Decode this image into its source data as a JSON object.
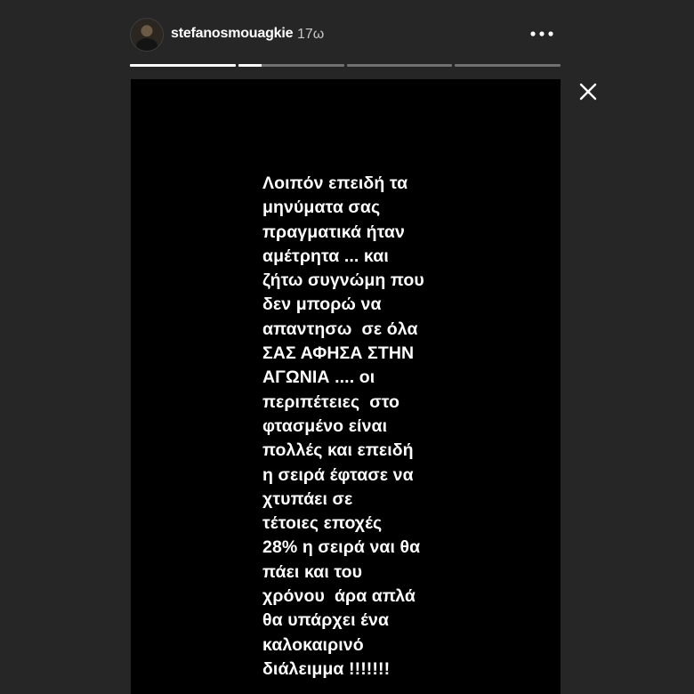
{
  "header": {
    "username": "stefanosmouagkie",
    "time_ago": "17ω",
    "avatar_icon": "profile-avatar",
    "more_icon": "more-horizontal-icon"
  },
  "progress": {
    "segment_count": 4,
    "segments_fill": [
      1,
      0.22,
      0,
      0
    ]
  },
  "close_icon": "close-icon",
  "story": {
    "text": "Λοιπόν επειδή τα\nμηνύματα σας\nπραγματικά ήταν\nαμέτρητα ... και\nζήτω συγνώμη που\nδεν μπορώ να\nαπαντησω  σε όλα\nΣΑΣ ΑΦΗΣΑ ΣΤΗΝ\nΑΓΩΝΙΑ .... οι\nπεριπέτειες  στο\nφτασμένο είναι\nπολλές και επειδή\nη σειρά έφτασε να\nχτυπάει σε\nτέτοιες εποχές\n28% η σειρά ναι θα\nπάει και του\nχρόνου  άρα απλά\nθα υπάρχει ένα\nκαλοκαιρινό\nδιάλειμμα !!!!!!!",
    "background_color": "#000000",
    "text_color": "#ffffff"
  }
}
